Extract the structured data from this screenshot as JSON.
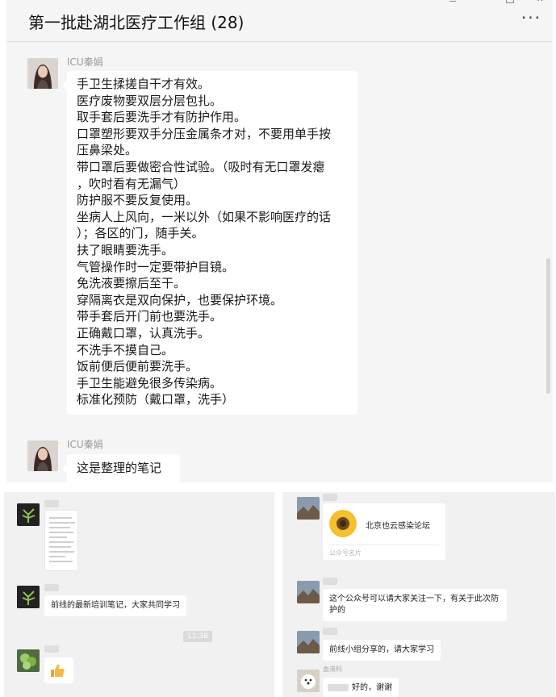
{
  "chat": {
    "title": "第一批赴湖北医疗工作组 (28)",
    "more_label": "···"
  },
  "messages": [
    {
      "sender": "ICU秦娟",
      "lines": [
        "手卫生揉搓自干才有效。",
        "医疗废物要双层分层包扎。",
        "取手套后要洗手才有防护作用。",
        "口罩塑形要双手分压金属条才对，不要用单手按",
        "压鼻梁处。",
        "带口罩后要做密合性试验。（吸时有无口罩发瘪",
        "，吹时看有无漏气）",
        "防护服不要反复使用。",
        "坐病人上风向，一米以外（如果不影响医疗的话",
        "）；各区的门，随手关。",
        "扶了眼睛要洗手。",
        "气管操作时一定要带护目镜。",
        "免洗液要擦后至干。",
        "穿隔离衣是双向保护，也要保护环境。",
        "带手套后开门前也要洗手。",
        "正确戴口罩，认真洗手。",
        "不洗手不摸自己。",
        "饭前便后便前要洗手。",
        "手卫生能避免很多传染病。",
        "标准化预防（戴口罩，洗手）"
      ]
    },
    {
      "sender": "ICU秦娟",
      "lines": [
        "这是整理的笔记"
      ]
    }
  ],
  "left_panel": {
    "caption": "前线的最新培训笔记，大家共同学习",
    "timestamp": "11:38",
    "thumbs_icon": "thumbs-up-icon"
  },
  "right_panel": {
    "card_name": "北京也云感染论坛",
    "card_label": "公众号名片",
    "msg1": "这个公众号可以请大家关注一下，有关于此次防护的",
    "msg2": "前线小组分享的，请大家学习",
    "last_name": "血液科",
    "last_msg": "好的，谢谢"
  },
  "colors": {
    "window_bg": "#f5f5f5",
    "bubble_bg": "#ffffff",
    "panel_bg": "#f1f1f1"
  }
}
